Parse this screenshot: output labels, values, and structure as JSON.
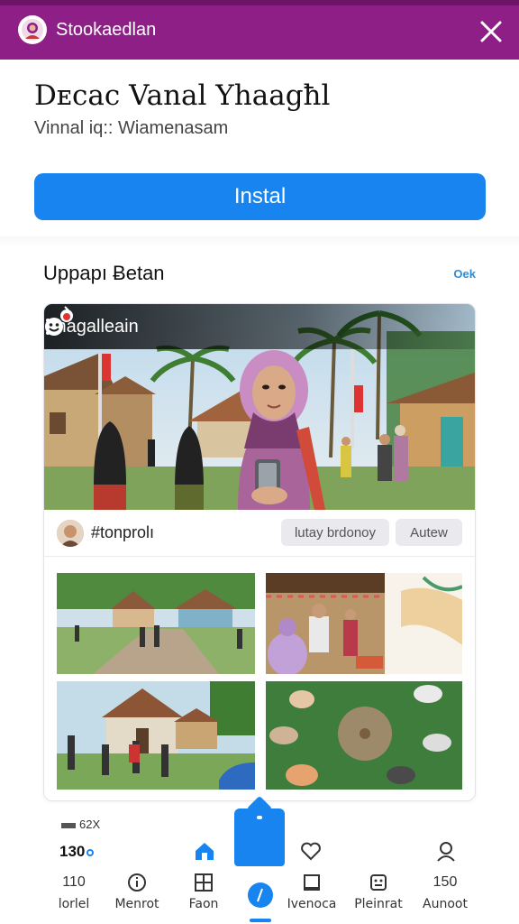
{
  "topbar": {
    "title": "Stookaedlan",
    "avatar_icon": "person-avatar-icon",
    "close_icon": "close-icon",
    "color": "#8e1f87"
  },
  "app": {
    "name": "Dᴇcac Vanal Yhaagħl",
    "subtitle": "Vinnal iq:: Wiamenasam",
    "install_label": "Instal",
    "install_color": "#1784f0"
  },
  "section": {
    "title": "Uppapı Ƀetan",
    "link": "Oek"
  },
  "card": {
    "hero_title": "ınagalleain",
    "profile_name": "#tonprolı",
    "chips": [
      "lutay brdonoy",
      "Autew"
    ]
  },
  "bottom": {
    "status_text": "62X",
    "count": "130",
    "nav": [
      {
        "icon_top": "110",
        "label": "lorlel"
      },
      {
        "icon": "info-circle-icon",
        "label": "Menrot"
      },
      {
        "icon": "grid-window-icon",
        "label": "Faon"
      },
      {
        "icon": "square-icon",
        "label": "Ivenoca"
      },
      {
        "icon": "robot-face-icon",
        "label": "Pleinrat"
      },
      {
        "icon_top": "150",
        "label": "Aunoot"
      }
    ]
  }
}
